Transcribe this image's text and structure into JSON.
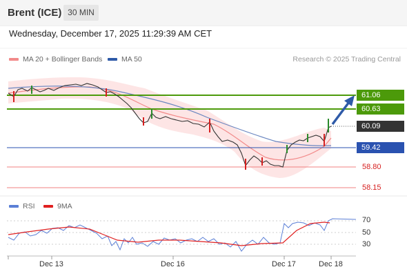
{
  "header": {
    "instrument": "Brent (ICE)",
    "timeframe": "30 MIN"
  },
  "datetime": "Wednesday, December 17, 2025 11:29:39 AM CET",
  "legend": {
    "ma20": "MA 20 + Bollinger Bands",
    "ma50": "MA 50",
    "ma20_color": "#f28a8a",
    "ma50_color": "#2e5aa8",
    "credit": "Research © 2025 Trading Central"
  },
  "levels": {
    "resistance": [
      "61.06",
      "60.63"
    ],
    "current": "60.09",
    "pivot": "59.42",
    "support": [
      "58.80",
      "58.15"
    ],
    "resistance_color": "#4c9a0a",
    "pivot_color": "#2a52b0",
    "support_color": "#f08080"
  },
  "rsi_legend": {
    "rsi": "RSI",
    "ma9": "9MA",
    "rsi_color": "#5b7fd6",
    "ma9_color": "#e02020"
  },
  "rsi_scale": [
    "70",
    "50",
    "30"
  ],
  "xaxis": [
    "Dec 13",
    "Dec 16",
    "Dec 17",
    "Dec 18"
  ],
  "chart_data": {
    "type": "line",
    "title": "Brent (ICE)",
    "x_labels": [
      "Dec 13",
      "Dec 16",
      "Dec 17",
      "Dec 18"
    ],
    "price_series": [
      {
        "t": 0,
        "p": 60.92
      },
      {
        "t": 4,
        "p": 60.96
      },
      {
        "t": 8,
        "p": 60.88
      },
      {
        "t": 12,
        "p": 60.93
      },
      {
        "t": 16,
        "p": 60.99
      },
      {
        "t": 20,
        "p": 61.0
      },
      {
        "t": 24,
        "p": 60.96
      },
      {
        "t": 28,
        "p": 60.86
      },
      {
        "t": 32,
        "p": 60.74
      },
      {
        "t": 36,
        "p": 60.6
      },
      {
        "t": 40,
        "p": 60.44
      },
      {
        "t": 44,
        "p": 60.2
      },
      {
        "t": 48,
        "p": 60.12
      },
      {
        "t": 52,
        "p": 60.3
      },
      {
        "t": 56,
        "p": 60.24
      },
      {
        "t": 60,
        "p": 60.2
      },
      {
        "t": 64,
        "p": 60.2
      },
      {
        "t": 68,
        "p": 60.1
      },
      {
        "t": 72,
        "p": 60.0
      },
      {
        "t": 76,
        "p": 59.76
      },
      {
        "t": 80,
        "p": 59.7
      },
      {
        "t": 84,
        "p": 59.6
      },
      {
        "t": 88,
        "p": 59.4
      },
      {
        "t": 92,
        "p": 59.2
      },
      {
        "t": 96,
        "p": 58.86
      },
      {
        "t": 100,
        "p": 59.1
      },
      {
        "t": 104,
        "p": 59.0
      },
      {
        "t": 108,
        "p": 58.84
      },
      {
        "t": 112,
        "p": 58.84
      },
      {
        "t": 116,
        "p": 59.45
      },
      {
        "t": 120,
        "p": 59.5
      },
      {
        "t": 124,
        "p": 59.6
      },
      {
        "t": 128,
        "p": 59.65
      },
      {
        "t": 132,
        "p": 59.65
      },
      {
        "t": 134,
        "p": 60.09
      }
    ],
    "ma50_series": [
      {
        "t": 0,
        "p": 60.8
      },
      {
        "t": 20,
        "p": 60.85
      },
      {
        "t": 40,
        "p": 60.7
      },
      {
        "t": 60,
        "p": 60.5
      },
      {
        "t": 80,
        "p": 60.1
      },
      {
        "t": 100,
        "p": 59.7
      },
      {
        "t": 120,
        "p": 59.45
      },
      {
        "t": 134,
        "p": 59.42
      }
    ],
    "projection": {
      "from": 60.09,
      "to": 61.06
    },
    "rsi_series": [
      {
        "t": 0,
        "v": 48
      },
      {
        "t": 10,
        "v": 55
      },
      {
        "t": 20,
        "v": 62
      },
      {
        "t": 30,
        "v": 58
      },
      {
        "t": 40,
        "v": 42
      },
      {
        "t": 50,
        "v": 40
      },
      {
        "t": 60,
        "v": 44
      },
      {
        "t": 70,
        "v": 46
      },
      {
        "t": 80,
        "v": 42
      },
      {
        "t": 90,
        "v": 38
      },
      {
        "t": 100,
        "v": 36
      },
      {
        "t": 110,
        "v": 35
      },
      {
        "t": 116,
        "v": 70
      },
      {
        "t": 124,
        "v": 74
      },
      {
        "t": 134,
        "v": 73
      }
    ],
    "rsi_scale": [
      30,
      50,
      70
    ]
  }
}
